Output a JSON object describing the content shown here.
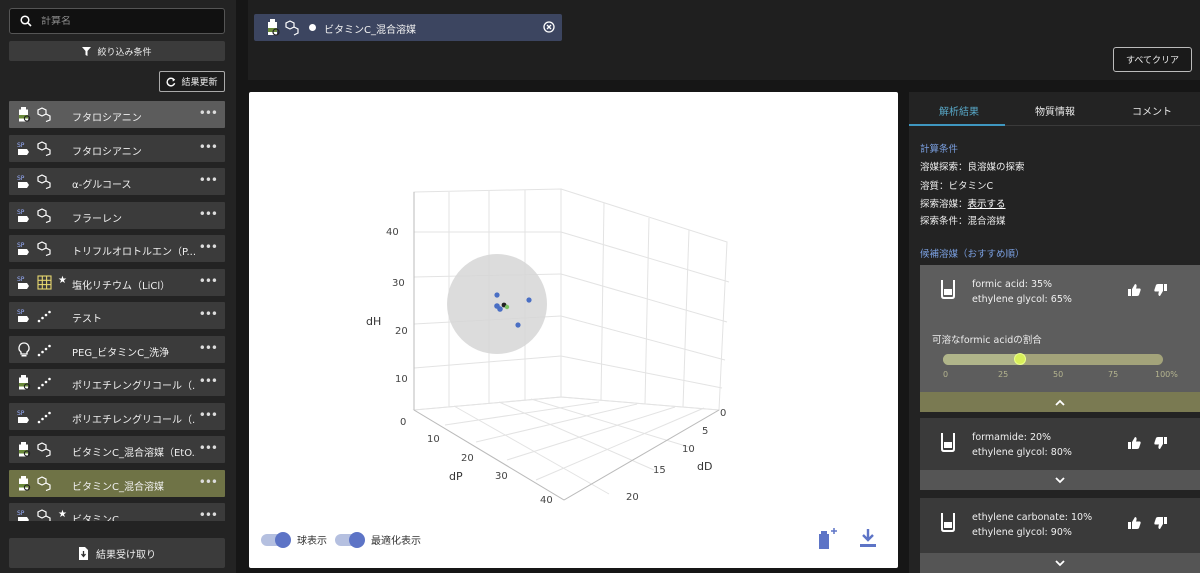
{
  "search": {
    "placeholder": "計算名"
  },
  "filter": {
    "label": "絞り込み条件"
  },
  "refresh": {
    "label": "結果更新"
  },
  "calc_items": [
    {
      "label": "フタロシアニン",
      "icon": "bottle-icon",
      "type": "molecule-icon",
      "star": false,
      "state": "selected"
    },
    {
      "label": "フタロシアニン",
      "icon": "sp-icon",
      "type": "molecule-icon",
      "star": false,
      "state": ""
    },
    {
      "label": "α-グルコース",
      "icon": "sp-icon",
      "type": "molecule-icon",
      "star": false,
      "state": ""
    },
    {
      "label": "フラーレン",
      "icon": "sp-icon",
      "type": "molecule-icon",
      "star": false,
      "state": ""
    },
    {
      "label": "トリフルオロトルエン（P...",
      "icon": "sp-icon",
      "type": "molecule-icon",
      "star": false,
      "state": ""
    },
    {
      "label": "塩化リチウム（LiCl）",
      "icon": "sp-icon",
      "type": "grid-icon",
      "star": true,
      "state": ""
    },
    {
      "label": "テスト",
      "icon": "sp-icon",
      "type": "line-icon",
      "star": false,
      "state": ""
    },
    {
      "label": "PEG_ビタミンC_洗浄",
      "icon": "bulb-icon",
      "type": "line-icon",
      "star": false,
      "state": ""
    },
    {
      "label": "ポリエチレングリコール（...",
      "icon": "bottle-icon",
      "type": "line-icon",
      "star": false,
      "state": ""
    },
    {
      "label": "ポリエチレングリコール（...",
      "icon": "sp-icon",
      "type": "line-icon",
      "star": false,
      "state": ""
    },
    {
      "label": "ビタミンC_混合溶媒（EtO...",
      "icon": "bottle-icon",
      "type": "molecule-icon",
      "star": false,
      "state": ""
    },
    {
      "label": "ビタミンC_混合溶媒",
      "icon": "bottle-icon",
      "type": "molecule-icon",
      "star": false,
      "state": "active"
    },
    {
      "label": "ビタミンC",
      "icon": "sp-icon",
      "type": "molecule-icon",
      "star": true,
      "state": ""
    }
  ],
  "calc_item_menu": "•••",
  "receive": {
    "label": "結果受け取り"
  },
  "chip": {
    "label": "ビタミンC_混合溶媒"
  },
  "clear_all": "すべてクリア",
  "plot": {
    "axis_dH": "dH",
    "axis_dP": "dP",
    "axis_dD": "dD",
    "ticks_dH": [
      "0",
      "10",
      "20",
      "30",
      "40"
    ],
    "ticks_dP": [
      "10",
      "20",
      "30",
      "40"
    ],
    "ticks_dD": [
      "0",
      "5",
      "10",
      "15",
      "20"
    ],
    "toggle_sphere": "球表示",
    "toggle_optimize": "最適化表示"
  },
  "tabs": [
    "解析結果",
    "物質情報",
    "コメント"
  ],
  "conditions": {
    "title": "計算条件",
    "line1": "溶媒探索：良溶媒の探索",
    "line2": "溶質：ビタミンC",
    "line3_prefix": "探索溶媒：",
    "line3_link": "表示する",
    "line4": "探索条件：混合溶媒"
  },
  "candidates": {
    "title": "候補溶媒（おすすめ順）",
    "cards": [
      {
        "line1": "formic acid: 35%",
        "line2": "ethylene glycol: 65%"
      },
      {
        "line1": "formamide: 20%",
        "line2": "ethylene glycol: 80%"
      },
      {
        "line1": "ethylene carbonate: 10%",
        "line2": "ethylene glycol: 90%"
      }
    ],
    "slider_label": "可溶なformic acidの割合",
    "slider_value": 35,
    "slider_ticks": [
      "0",
      "25",
      "50",
      "75",
      "100%"
    ]
  },
  "colors": {
    "accent": "#3f97c0",
    "point": "#4a6fc4",
    "active_row": "#6f7346",
    "chip": "#3c4560"
  }
}
